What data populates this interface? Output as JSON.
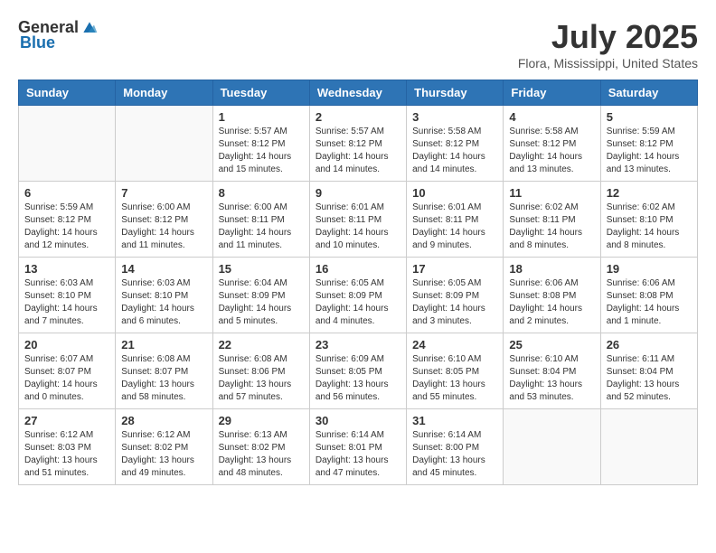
{
  "header": {
    "logo_general": "General",
    "logo_blue": "Blue",
    "title": "July 2025",
    "location": "Flora, Mississippi, United States"
  },
  "weekdays": [
    "Sunday",
    "Monday",
    "Tuesday",
    "Wednesday",
    "Thursday",
    "Friday",
    "Saturday"
  ],
  "weeks": [
    [
      {
        "day": "",
        "info": ""
      },
      {
        "day": "",
        "info": ""
      },
      {
        "day": "1",
        "info": "Sunrise: 5:57 AM\nSunset: 8:12 PM\nDaylight: 14 hours and 15 minutes."
      },
      {
        "day": "2",
        "info": "Sunrise: 5:57 AM\nSunset: 8:12 PM\nDaylight: 14 hours and 14 minutes."
      },
      {
        "day": "3",
        "info": "Sunrise: 5:58 AM\nSunset: 8:12 PM\nDaylight: 14 hours and 14 minutes."
      },
      {
        "day": "4",
        "info": "Sunrise: 5:58 AM\nSunset: 8:12 PM\nDaylight: 14 hours and 13 minutes."
      },
      {
        "day": "5",
        "info": "Sunrise: 5:59 AM\nSunset: 8:12 PM\nDaylight: 14 hours and 13 minutes."
      }
    ],
    [
      {
        "day": "6",
        "info": "Sunrise: 5:59 AM\nSunset: 8:12 PM\nDaylight: 14 hours and 12 minutes."
      },
      {
        "day": "7",
        "info": "Sunrise: 6:00 AM\nSunset: 8:12 PM\nDaylight: 14 hours and 11 minutes."
      },
      {
        "day": "8",
        "info": "Sunrise: 6:00 AM\nSunset: 8:11 PM\nDaylight: 14 hours and 11 minutes."
      },
      {
        "day": "9",
        "info": "Sunrise: 6:01 AM\nSunset: 8:11 PM\nDaylight: 14 hours and 10 minutes."
      },
      {
        "day": "10",
        "info": "Sunrise: 6:01 AM\nSunset: 8:11 PM\nDaylight: 14 hours and 9 minutes."
      },
      {
        "day": "11",
        "info": "Sunrise: 6:02 AM\nSunset: 8:11 PM\nDaylight: 14 hours and 8 minutes."
      },
      {
        "day": "12",
        "info": "Sunrise: 6:02 AM\nSunset: 8:10 PM\nDaylight: 14 hours and 8 minutes."
      }
    ],
    [
      {
        "day": "13",
        "info": "Sunrise: 6:03 AM\nSunset: 8:10 PM\nDaylight: 14 hours and 7 minutes."
      },
      {
        "day": "14",
        "info": "Sunrise: 6:03 AM\nSunset: 8:10 PM\nDaylight: 14 hours and 6 minutes."
      },
      {
        "day": "15",
        "info": "Sunrise: 6:04 AM\nSunset: 8:09 PM\nDaylight: 14 hours and 5 minutes."
      },
      {
        "day": "16",
        "info": "Sunrise: 6:05 AM\nSunset: 8:09 PM\nDaylight: 14 hours and 4 minutes."
      },
      {
        "day": "17",
        "info": "Sunrise: 6:05 AM\nSunset: 8:09 PM\nDaylight: 14 hours and 3 minutes."
      },
      {
        "day": "18",
        "info": "Sunrise: 6:06 AM\nSunset: 8:08 PM\nDaylight: 14 hours and 2 minutes."
      },
      {
        "day": "19",
        "info": "Sunrise: 6:06 AM\nSunset: 8:08 PM\nDaylight: 14 hours and 1 minute."
      }
    ],
    [
      {
        "day": "20",
        "info": "Sunrise: 6:07 AM\nSunset: 8:07 PM\nDaylight: 14 hours and 0 minutes."
      },
      {
        "day": "21",
        "info": "Sunrise: 6:08 AM\nSunset: 8:07 PM\nDaylight: 13 hours and 58 minutes."
      },
      {
        "day": "22",
        "info": "Sunrise: 6:08 AM\nSunset: 8:06 PM\nDaylight: 13 hours and 57 minutes."
      },
      {
        "day": "23",
        "info": "Sunrise: 6:09 AM\nSunset: 8:05 PM\nDaylight: 13 hours and 56 minutes."
      },
      {
        "day": "24",
        "info": "Sunrise: 6:10 AM\nSunset: 8:05 PM\nDaylight: 13 hours and 55 minutes."
      },
      {
        "day": "25",
        "info": "Sunrise: 6:10 AM\nSunset: 8:04 PM\nDaylight: 13 hours and 53 minutes."
      },
      {
        "day": "26",
        "info": "Sunrise: 6:11 AM\nSunset: 8:04 PM\nDaylight: 13 hours and 52 minutes."
      }
    ],
    [
      {
        "day": "27",
        "info": "Sunrise: 6:12 AM\nSunset: 8:03 PM\nDaylight: 13 hours and 51 minutes."
      },
      {
        "day": "28",
        "info": "Sunrise: 6:12 AM\nSunset: 8:02 PM\nDaylight: 13 hours and 49 minutes."
      },
      {
        "day": "29",
        "info": "Sunrise: 6:13 AM\nSunset: 8:02 PM\nDaylight: 13 hours and 48 minutes."
      },
      {
        "day": "30",
        "info": "Sunrise: 6:14 AM\nSunset: 8:01 PM\nDaylight: 13 hours and 47 minutes."
      },
      {
        "day": "31",
        "info": "Sunrise: 6:14 AM\nSunset: 8:00 PM\nDaylight: 13 hours and 45 minutes."
      },
      {
        "day": "",
        "info": ""
      },
      {
        "day": "",
        "info": ""
      }
    ]
  ]
}
